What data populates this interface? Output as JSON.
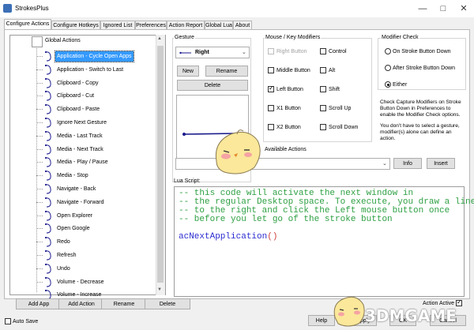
{
  "window": {
    "title": "StrokesPlus"
  },
  "tabs": [
    "Configure Actions",
    "Configure Hotkeys",
    "Ignored List",
    "Preferences",
    "Action Report",
    "Global Lua",
    "About"
  ],
  "tree": {
    "root": "Global Actions",
    "items": [
      {
        "label": "Application - Cycle Open Apps",
        "icon": "arrow-right-gesture-icon"
      },
      {
        "label": "Application - Switch to Last",
        "icon": "arrow-right-gesture-icon"
      },
      {
        "label": "Clipboard - Copy",
        "icon": "letter-c-gesture-icon"
      },
      {
        "label": "Clipboard - Cut",
        "icon": "letter-x-gesture-icon"
      },
      {
        "label": "Clipboard - Paste",
        "icon": "letter-p-gesture-icon"
      },
      {
        "label": "Ignore Next Gesture",
        "icon": "letter-i-gesture-icon"
      },
      {
        "label": "Media - Last Track",
        "icon": "letter-l-gesture-icon"
      },
      {
        "label": "Media - Next Track",
        "icon": "letter-n-gesture-icon"
      },
      {
        "label": "Media - Play / Pause",
        "icon": "letter-p-gesture-icon"
      },
      {
        "label": "Media - Stop",
        "icon": "letter-s-gesture-icon"
      },
      {
        "label": "Navigate - Back",
        "icon": "arrow-left-gesture-icon"
      },
      {
        "label": "Navigate - Forward",
        "icon": "arrow-right-gesture-icon"
      },
      {
        "label": "Open Explorer",
        "icon": "letter-e-gesture-icon"
      },
      {
        "label": "Open Google",
        "icon": "letter-g-gesture-icon"
      },
      {
        "label": "Redo",
        "icon": "letter-r-gesture-icon"
      },
      {
        "label": "Refresh",
        "icon": "letter-r-gesture-icon"
      },
      {
        "label": "Undo",
        "icon": "letter-u-gesture-icon"
      },
      {
        "label": "Volume - Decrease",
        "icon": "letter-v-gesture-icon"
      },
      {
        "label": "Volume - Increase",
        "icon": "letter-v-gesture-icon"
      }
    ]
  },
  "bottom_buttons": {
    "add_app": "Add App",
    "add_action": "Add Action",
    "rename": "Rename",
    "delete": "Delete"
  },
  "gesture": {
    "group_label": "Gesture",
    "selected": "Right",
    "new": "New",
    "rename": "Rename",
    "delete": "Delete"
  },
  "modifiers": {
    "group_label": "Mouse / Key Modifiers",
    "items": [
      {
        "label": "Right Button",
        "checked": false,
        "disabled": true
      },
      {
        "label": "Control",
        "checked": false
      },
      {
        "label": "Middle Button",
        "checked": false
      },
      {
        "label": "Alt",
        "checked": false
      },
      {
        "label": "Left Button",
        "checked": true
      },
      {
        "label": "Shift",
        "checked": false
      },
      {
        "label": "X1 Button",
        "checked": false
      },
      {
        "label": "Scroll Up",
        "checked": false
      },
      {
        "label": "X2 Button",
        "checked": false
      },
      {
        "label": "Scroll Down",
        "checked": false
      }
    ]
  },
  "modifier_check": {
    "group_label": "Modifier Check",
    "options": [
      {
        "label": "On Stroke Button Down",
        "selected": false
      },
      {
        "label": "After Stroke Button Down",
        "selected": false
      },
      {
        "label": "Either",
        "selected": true
      }
    ],
    "note1": "Check Capture Modifiers on Stroke Button Down in Preferences to enable the Modifier Check options.",
    "note2": "You don't have to select a gesture, modifier(s) alone can define an action."
  },
  "available_actions": {
    "label": "Available Actions",
    "info": "Info",
    "insert": "Insert"
  },
  "lua": {
    "label": "Lua Script:",
    "lines": [
      "-- this code will activate the next window in",
      "-- the regular Desktop space. To execute, you draw a line",
      "-- to the right and click the Left mouse button once",
      "-- before you let go of the stroke button"
    ],
    "code_fn": "acNextApplication",
    "code_paren": "()"
  },
  "footer": {
    "auto_save": "Auto Save",
    "action_active": "Action Active",
    "help": "Help",
    "apply": "Apply",
    "ok": "OK",
    "cancel": "Cancel"
  },
  "watermark": "3DMGAME",
  "colors": {
    "selection": "#3399ff",
    "comment": "#2ea043",
    "code": "#2b2bd1",
    "gesture_stroke": "#1a1a8c"
  }
}
